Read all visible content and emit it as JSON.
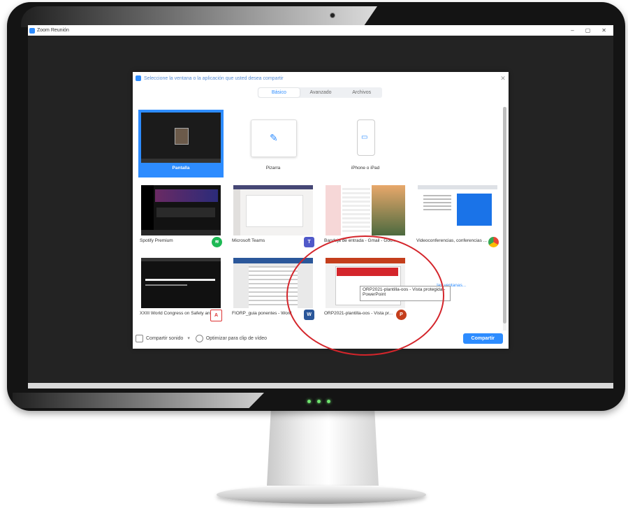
{
  "window": {
    "title": "Zoom Reunión",
    "controls": [
      "–",
      "▢",
      "✕"
    ]
  },
  "dialog": {
    "header": "Seleccione la ventana o la aplicación que usted desea compartir",
    "tabs": [
      {
        "label": "Básico",
        "active": true
      },
      {
        "label": "Avanzado",
        "active": false
      },
      {
        "label": "Archivos",
        "active": false
      }
    ],
    "items": [
      {
        "label": "Pantalla",
        "selected": true
      },
      {
        "label": "Pizarra",
        "selected": false
      },
      {
        "label": "iPhone o iPad",
        "selected": false
      },
      {
        "label": "Spotify Premium",
        "app_icon": "spotify-icon"
      },
      {
        "label": "Microsoft Teams",
        "app_icon": "teams-icon"
      },
      {
        "label": "Bandeja de entrada - Gmail - Goo...",
        "app_icon": "none"
      },
      {
        "label": "Videoconferencias, conferencias ...",
        "app_icon": "chrome-icon"
      },
      {
        "label": "XXIII World Congress on Safety an...",
        "app_icon": "pdf-icon"
      },
      {
        "label": "FIORP_guia ponentes - Word",
        "app_icon": "word-icon"
      },
      {
        "label": "ORP2021-plantilla-oos - Vista pr...",
        "app_icon": "powerpoint-icon"
      }
    ],
    "more_windows_link": "... las ventanas...",
    "tooltip": "ORP2021-plantilla-oos - Vista protegida - PowerPoint",
    "footer": {
      "share_sound": "Compartir sonido",
      "sound_arrow": "▾",
      "optimize_video": "Optimizar para clip de vídeo",
      "share_button": "Compartir"
    }
  },
  "colors": {
    "zoom_blue": "#2d8cff",
    "highlight_red": "#d4252b"
  }
}
